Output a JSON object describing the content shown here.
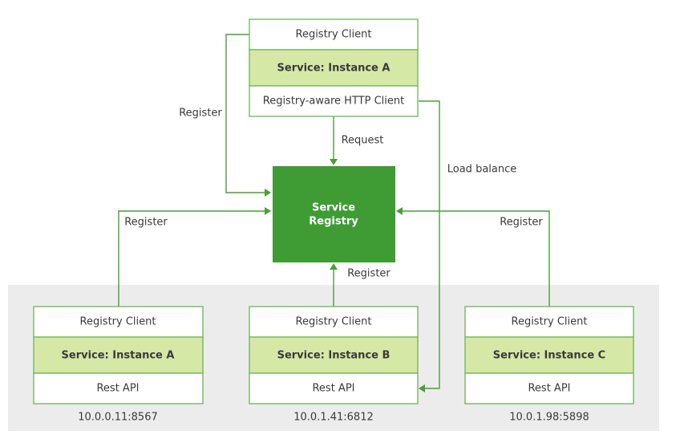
{
  "colors": {
    "registry": "#3f9c35",
    "service_row": "#d5e8a6",
    "line": "#4a9e3c",
    "border": "#6db35a",
    "zone": "#ececec"
  },
  "top_instance": {
    "client": "Registry Client",
    "service": "Service:  Instance A",
    "http": "Registry-aware HTTP Client"
  },
  "registry": {
    "line1": "Service",
    "line2": "Registry"
  },
  "labels": {
    "register_top": "Register",
    "request": "Request",
    "load_balance": "Load balance",
    "register_a": "Register",
    "register_b": "Register",
    "register_c": "Register"
  },
  "instances": [
    {
      "client": "Registry Client",
      "service": "Service:  Instance A",
      "api": "Rest API",
      "address": "10.0.0.11:8567"
    },
    {
      "client": "Registry Client",
      "service": "Service:  Instance B",
      "api": "Rest API",
      "address": "10.0.1.41:6812"
    },
    {
      "client": "Registry Client",
      "service": "Service:  Instance C",
      "api": "Rest API",
      "address": "10.0.1.98:5898"
    }
  ]
}
